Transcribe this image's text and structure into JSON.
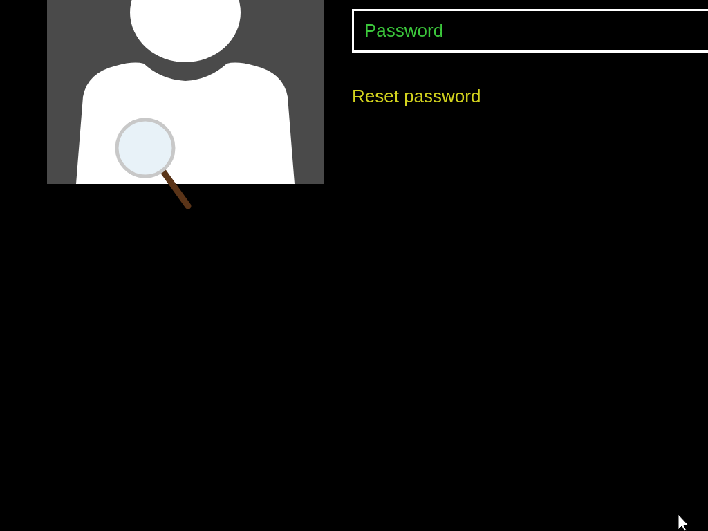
{
  "password_field": {
    "placeholder": "Password"
  },
  "reset_link": {
    "label": "Reset password"
  }
}
